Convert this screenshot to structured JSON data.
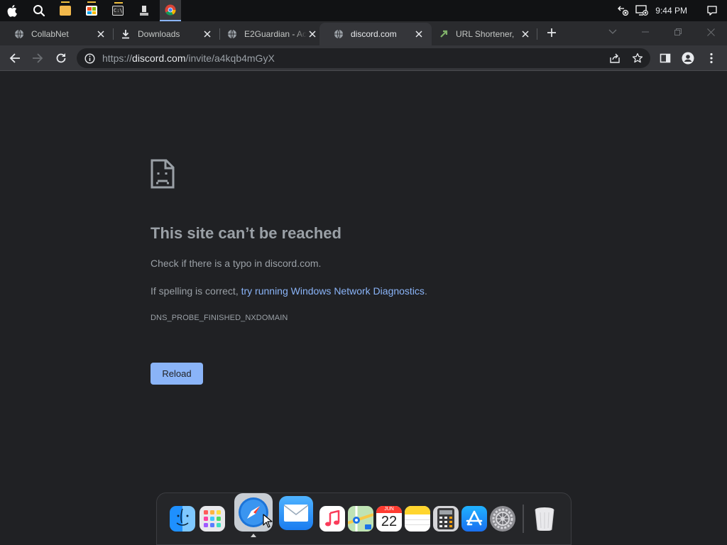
{
  "os": {
    "clock": "9:44 PM"
  },
  "tabs": [
    {
      "title": "CollabNet",
      "favicon": "globe-icon"
    },
    {
      "title": "Downloads",
      "favicon": "download-icon"
    },
    {
      "title": "E2Guardian - Ac",
      "favicon": "globe-icon"
    },
    {
      "title": "discord.com",
      "favicon": "globe-icon",
      "active": true
    },
    {
      "title": "URL Shortener,",
      "favicon": "link-shortener-icon"
    }
  ],
  "address": {
    "scheme": "https://",
    "host": "discord.com",
    "path": "/invite/a4kqb4mGyX"
  },
  "error": {
    "title": "This site can’t be reached",
    "check_text": "Check if there is a typo in discord.com.",
    "spell_prefix": "If spelling is correct, ",
    "spell_link": "try running Windows Network Diagnostics",
    "spell_suffix": ".",
    "code": "DNS_PROBE_FINISHED_NXDOMAIN",
    "reload_label": "Reload"
  },
  "dock": {
    "items": [
      "finder-icon",
      "launchpad-icon",
      "safari-icon",
      "mail-icon",
      "music-icon",
      "maps-icon",
      "calendar-icon",
      "notes-icon",
      "calculator-icon",
      "app-store-icon",
      "system-preferences-icon",
      "trash-icon"
    ],
    "calendar_month": "JUN",
    "calendar_day": "22"
  },
  "colors": {
    "background": "#202124",
    "accent": "#8ab4f8",
    "text_muted": "#9aa0a6"
  }
}
